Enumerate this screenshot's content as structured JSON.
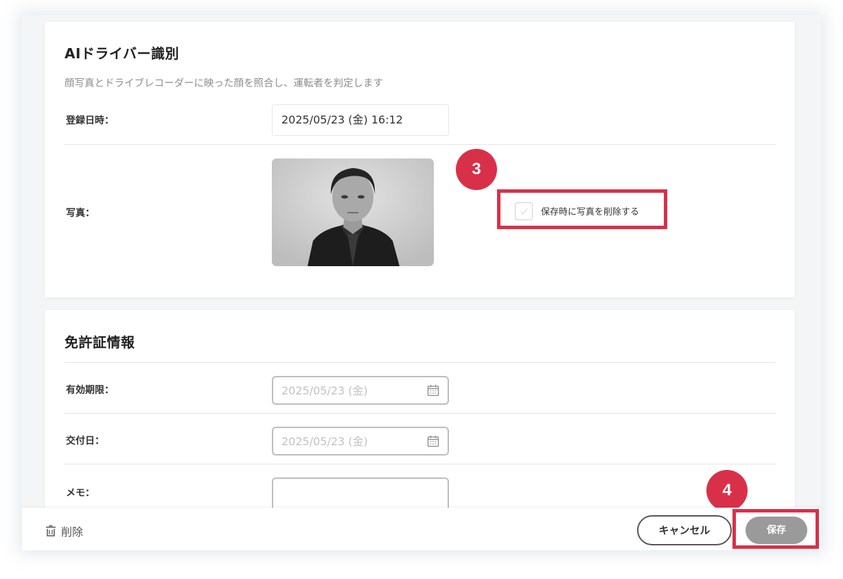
{
  "ai_driver": {
    "title": "AIドライバー識別",
    "description": "顔写真とドライブレコーダーに映った顔を照合し、運転者を判定します",
    "registered_label": "登録日時：",
    "registered_value": "2025/05/23 (金) 16:12",
    "photo_label": "写真：",
    "delete_photo_label": "保存時に写真を削除する",
    "delete_photo_checked": false
  },
  "license": {
    "title": "免許証情報",
    "expiry_label": "有効期限：",
    "expiry_placeholder": "2025/05/23 (金)",
    "issue_label": "交付日：",
    "issue_placeholder": "2025/05/23 (金)",
    "memo_label": "メモ：",
    "memo_value": ""
  },
  "badges": {
    "step3": "3",
    "step4": "4"
  },
  "footer": {
    "delete_label": "削除",
    "cancel_label": "キャンセル",
    "save_label": "保存"
  },
  "colors": {
    "highlight": "#d9304a",
    "save_button": "#9a9a9a"
  },
  "icons": {
    "calendar": "calendar-icon",
    "trash": "trash-icon",
    "check": "checkmark-icon"
  }
}
